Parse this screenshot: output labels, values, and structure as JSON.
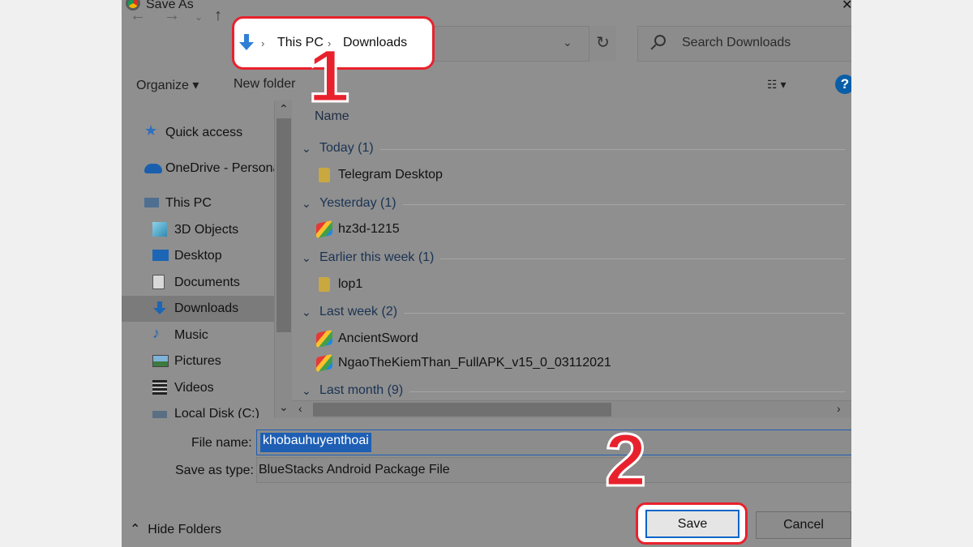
{
  "window": {
    "title": "Save As"
  },
  "address": {
    "crumbs": [
      "This PC",
      "Downloads"
    ]
  },
  "search": {
    "placeholder": "Search Downloads"
  },
  "toolbar": {
    "organize": "Organize",
    "new_folder": "New folder",
    "help": "?"
  },
  "nav": {
    "items": [
      {
        "label": "Quick access",
        "icon": "star-icon"
      },
      {
        "label": "OneDrive - Persona",
        "icon": "cloud-icon"
      },
      {
        "label": "This PC",
        "icon": "computer-icon"
      },
      {
        "label": "3D Objects",
        "icon": "cube-icon"
      },
      {
        "label": "Desktop",
        "icon": "desktop-icon"
      },
      {
        "label": "Documents",
        "icon": "document-icon"
      },
      {
        "label": "Downloads",
        "icon": "download-icon",
        "selected": true
      },
      {
        "label": "Music",
        "icon": "music-icon"
      },
      {
        "label": "Pictures",
        "icon": "picture-icon"
      },
      {
        "label": "Videos",
        "icon": "video-icon"
      },
      {
        "label": "Local Disk (C:)",
        "icon": "disk-icon"
      }
    ]
  },
  "files": {
    "column_name": "Name",
    "groups": [
      {
        "label": "Today (1)",
        "items": [
          "Telegram Desktop"
        ]
      },
      {
        "label": "Yesterday (1)",
        "items": [
          "hz3d-1215"
        ]
      },
      {
        "label": "Earlier this week (1)",
        "items": [
          "lop1"
        ]
      },
      {
        "label": "Last week (2)",
        "items": [
          "AncientSword",
          "NgaoTheKiemThan_FullAPK_v15_0_03112021"
        ]
      },
      {
        "label": "Last month (9)",
        "items": []
      }
    ]
  },
  "form": {
    "file_name_label": "File name:",
    "file_name_value": "khobauhuyenthoai",
    "save_type_label": "Save as type:",
    "save_type_value": "BlueStacks Android Package File"
  },
  "footer": {
    "hide_folders": "Hide Folders",
    "save": "Save",
    "cancel": "Cancel"
  },
  "annotations": {
    "step1": "1",
    "step2": "2"
  },
  "colors": {
    "highlight": "#e8222d",
    "accent": "#1e5fb4"
  }
}
